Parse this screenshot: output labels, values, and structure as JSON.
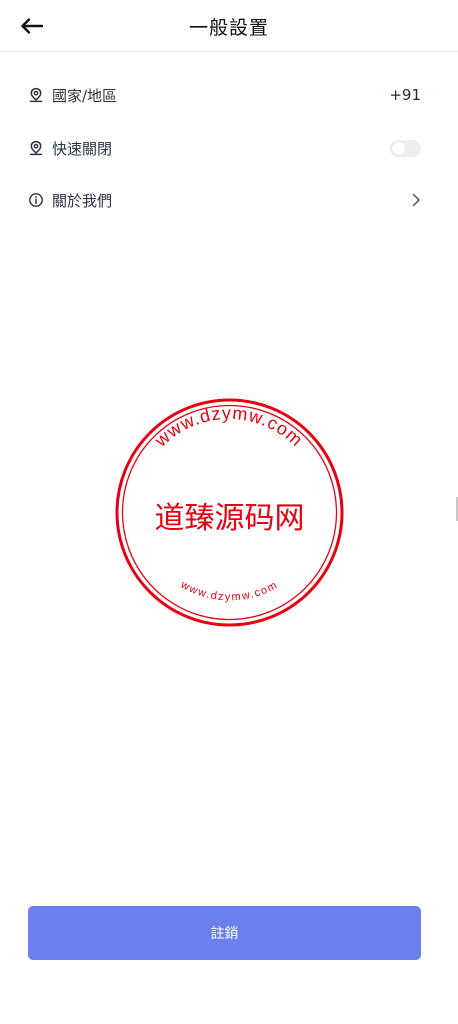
{
  "header": {
    "title": "一般設置",
    "back_icon": "arrow-left-icon"
  },
  "settings": [
    {
      "label": "國家/地區",
      "icon": "location-pin-icon",
      "value": "+91"
    },
    {
      "label": "快速關閉",
      "icon": "location-pin-icon",
      "toggle_on": false
    },
    {
      "label": "關於我們",
      "icon": "info-circle-icon",
      "chevron": "chevron-right-icon"
    }
  ],
  "watermark": {
    "text": "道臻源码网",
    "url_top": "www.dzymw.com",
    "url_bottom": "www.dzymw.com",
    "color": "#e60012"
  },
  "footer": {
    "logout_label": "註銷",
    "button_color": "#6b80ec"
  }
}
